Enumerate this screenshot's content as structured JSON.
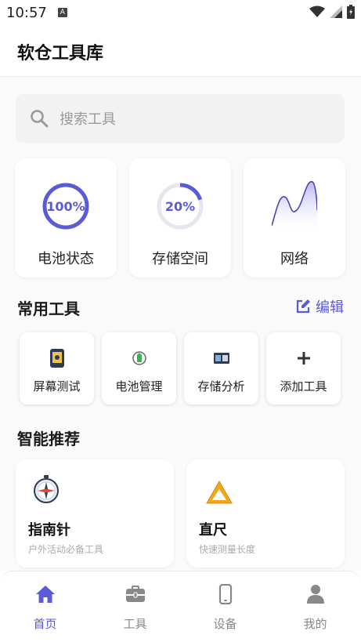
{
  "status_bar": {
    "time": "10:57",
    "notification_icon": "A"
  },
  "app_title": "软仓工具库",
  "search": {
    "placeholder": "搜索工具"
  },
  "stats": [
    {
      "label": "电池状态",
      "value_text": "100%",
      "percent": 100
    },
    {
      "label": "存储空间",
      "value_text": "20%",
      "percent": 20
    },
    {
      "label": "网络"
    }
  ],
  "common_tools": {
    "title": "常用工具",
    "edit_label": "编辑",
    "items": [
      {
        "label": "屏幕测试",
        "icon": "phone-screen-icon"
      },
      {
        "label": "电池管理",
        "icon": "battery-icon"
      },
      {
        "label": "存储分析",
        "icon": "storage-icon"
      },
      {
        "label": "添加工具",
        "icon": "plus-icon"
      }
    ]
  },
  "recommend": {
    "title": "智能推荐",
    "items": [
      {
        "title": "指南针",
        "subtitle": "户外活动必备工具",
        "icon": "compass-icon"
      },
      {
        "title": "直尺",
        "subtitle": "快速测量长度",
        "icon": "ruler-icon"
      }
    ]
  },
  "nav": {
    "items": [
      {
        "label": "首页",
        "icon": "home-icon",
        "active": true
      },
      {
        "label": "工具",
        "icon": "toolbox-icon",
        "active": false
      },
      {
        "label": "设备",
        "icon": "device-icon",
        "active": false
      },
      {
        "label": "我的",
        "icon": "user-icon",
        "active": false
      }
    ]
  },
  "colors": {
    "accent": "#5b5bd6",
    "ring_track": "#e6e6ee"
  }
}
